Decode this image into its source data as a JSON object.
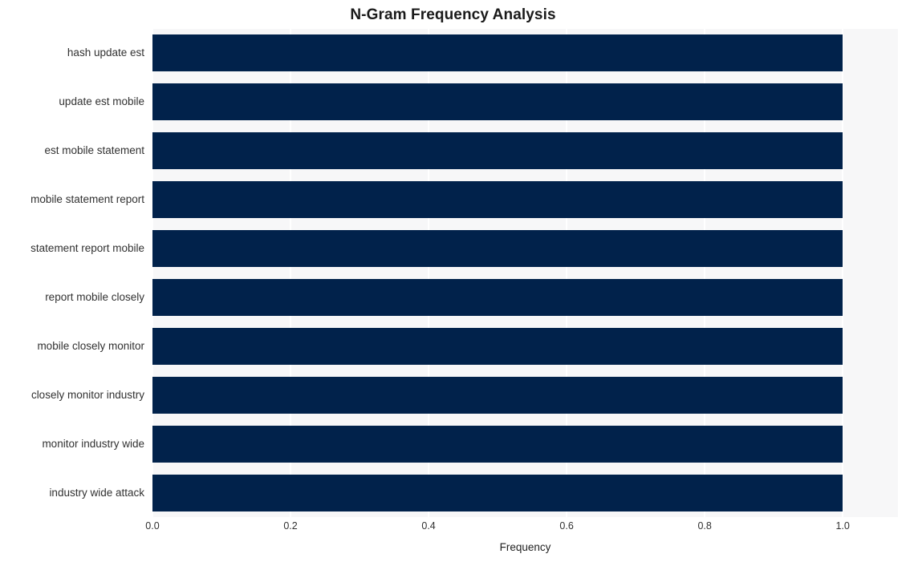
{
  "chart_data": {
    "type": "bar",
    "orientation": "horizontal",
    "title": "N-Gram Frequency Analysis",
    "xlabel": "Frequency",
    "ylabel": "",
    "categories": [
      "hash update est",
      "update est mobile",
      "est mobile statement",
      "mobile statement report",
      "statement report mobile",
      "report mobile closely",
      "mobile closely monitor",
      "closely monitor industry",
      "monitor industry wide",
      "industry wide attack"
    ],
    "values": [
      1.0,
      1.0,
      1.0,
      1.0,
      1.0,
      1.0,
      1.0,
      1.0,
      1.0,
      1.0
    ],
    "xlim": [
      0.0,
      1.08
    ],
    "xticks": [
      0.0,
      0.2,
      0.4,
      0.6,
      0.8,
      1.0
    ],
    "xtick_labels": [
      "0.0",
      "0.2",
      "0.4",
      "0.6",
      "0.8",
      "1.0"
    ],
    "grid": true,
    "grid_axis": "x",
    "legend": false,
    "bar_color": "#01224b",
    "plot_background": "#f7f7f8",
    "figure_background": "#ffffff",
    "gridline_color": "#ffffff",
    "title_color": "#1a1a1a",
    "tick_label_color": "#313131"
  }
}
